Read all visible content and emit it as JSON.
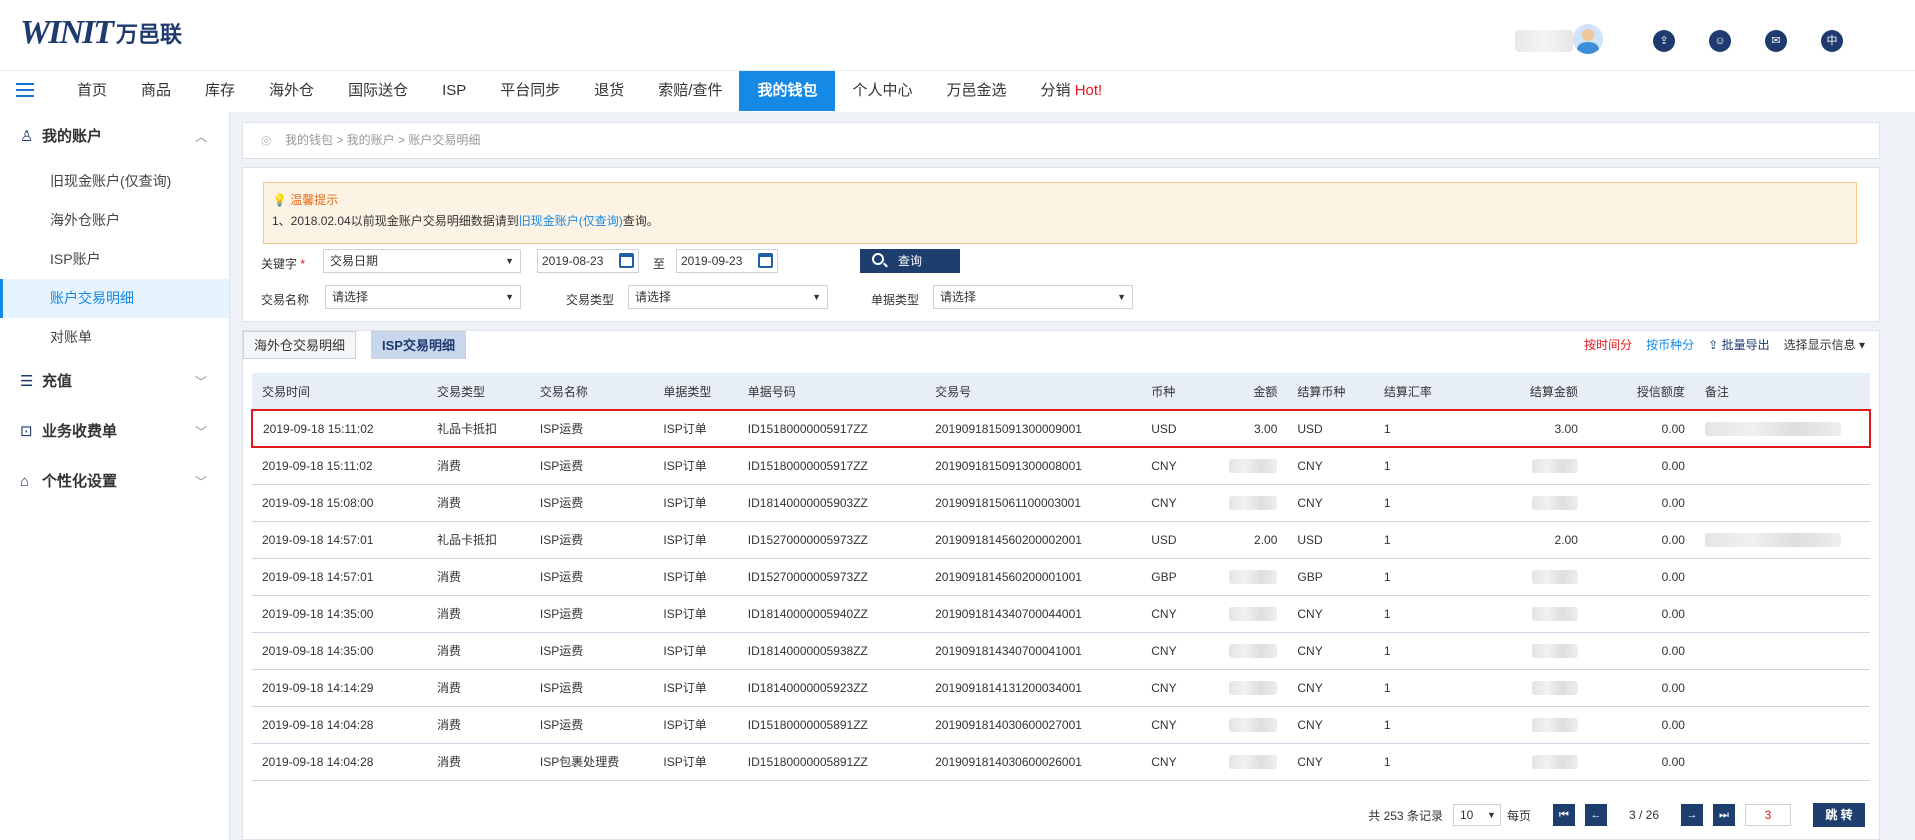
{
  "logo": {
    "mark": "WINIT",
    "cn": "万邑联"
  },
  "top_icons": {
    "lang": "中"
  },
  "nav": [
    "首页",
    "商品",
    "库存",
    "海外仓",
    "国际送仓",
    "ISP",
    "平台同步",
    "退货",
    "索赔/查件",
    "我的钱包",
    "个人中心",
    "万邑金选",
    "分销"
  ],
  "nav_hot": "Hot!",
  "sidebar": {
    "account_group": "我的账户",
    "account_items": [
      "旧现金账户(仅查询)",
      "海外仓账户",
      "ISP账户",
      "账户交易明细",
      "对账单"
    ],
    "recharge": "充值",
    "billing": "业务收费单",
    "personal": "个性化设置"
  },
  "breadcrumb": "我的钱包 > 我的账户 > 账户交易明细",
  "tip": {
    "title": "温馨提示",
    "line_prefix": "1、2018.02.04以前现金账户交易明细数据请到",
    "line_link": "旧现金账户(仅查询)",
    "line_suffix": "查询。"
  },
  "filters": {
    "keyword_label": "关键字",
    "keyword_star": "*",
    "keyword_value": "交易日期",
    "date_from": "2019-08-23",
    "to_label": "至",
    "date_to": "2019-09-23",
    "query_label": "查询",
    "name_label": "交易名称",
    "name_value": "请选择",
    "type_label": "交易类型",
    "type_value": "请选择",
    "doc_label": "单据类型",
    "doc_value": "请选择"
  },
  "tabs": [
    "海外仓交易明细",
    "ISP交易明细"
  ],
  "tools": {
    "by_time": "按时间分",
    "by_currency": "按币种分",
    "export": "批量导出",
    "display": "选择显示信息"
  },
  "table": {
    "headers": [
      "交易时间",
      "交易类型",
      "交易名称",
      "单据类型",
      "单据号码",
      "交易号",
      "币种",
      "金额",
      "结算币种",
      "结算汇率",
      "结算金额",
      "授信额度",
      "备注"
    ],
    "rows": [
      [
        "2019-09-18 15:11:02",
        "礼品卡抵扣",
        "ISP运费",
        "ISP订单",
        "ID15180000005917ZZ",
        "2019091815091300009001",
        "USD",
        "3.00",
        "USD",
        "1",
        "3.00",
        "0.00",
        ""
      ],
      [
        "2019-09-18 15:11:02",
        "消费",
        "ISP运费",
        "ISP订单",
        "ID15180000005917ZZ",
        "2019091815091300008001",
        "CNY",
        "",
        "CNY",
        "1",
        "",
        "0.00",
        ""
      ],
      [
        "2019-09-18 15:08:00",
        "消费",
        "ISP运费",
        "ISP订单",
        "ID18140000005903ZZ",
        "2019091815061100003001",
        "CNY",
        "",
        "CNY",
        "1",
        "",
        "0.00",
        ""
      ],
      [
        "2019-09-18 14:57:01",
        "礼品卡抵扣",
        "ISP运费",
        "ISP订单",
        "ID15270000005973ZZ",
        "2019091814560200002001",
        "USD",
        "2.00",
        "USD",
        "1",
        "2.00",
        "0.00",
        ""
      ],
      [
        "2019-09-18 14:57:01",
        "消费",
        "ISP运费",
        "ISP订单",
        "ID15270000005973ZZ",
        "2019091814560200001001",
        "GBP",
        "",
        "GBP",
        "1",
        "",
        "0.00",
        ""
      ],
      [
        "2019-09-18 14:35:00",
        "消费",
        "ISP运费",
        "ISP订单",
        "ID18140000005940ZZ",
        "2019091814340700044001",
        "CNY",
        "",
        "CNY",
        "1",
        "",
        "0.00",
        ""
      ],
      [
        "2019-09-18 14:35:00",
        "消费",
        "ISP运费",
        "ISP订单",
        "ID18140000005938ZZ",
        "2019091814340700041001",
        "CNY",
        "",
        "CNY",
        "1",
        "",
        "0.00",
        ""
      ],
      [
        "2019-09-18 14:14:29",
        "消费",
        "ISP运费",
        "ISP订单",
        "ID18140000005923ZZ",
        "2019091814131200034001",
        "CNY",
        "",
        "CNY",
        "1",
        "",
        "0.00",
        ""
      ],
      [
        "2019-09-18 14:04:28",
        "消费",
        "ISP运费",
        "ISP订单",
        "ID15180000005891ZZ",
        "2019091814030600027001",
        "CNY",
        "",
        "CNY",
        "1",
        "",
        "0.00",
        ""
      ],
      [
        "2019-09-18 14:04:28",
        "消费",
        "ISP包裹处理费",
        "ISP订单",
        "ID15180000005891ZZ",
        "2019091814030600026001",
        "CNY",
        "",
        "CNY",
        "1",
        "",
        "0.00",
        ""
      ]
    ]
  },
  "pager": {
    "total": "共 253 条记录",
    "page_size": "10",
    "per_page": "每页",
    "first": "⏮",
    "prev": "←",
    "status": "3 / 26",
    "next": "→",
    "last": "⏭",
    "jump_value": "3",
    "jump_label": "跳 转"
  }
}
